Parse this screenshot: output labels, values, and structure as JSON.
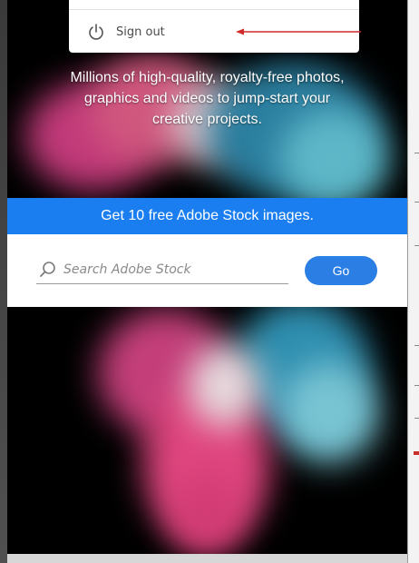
{
  "hero": {
    "tagline_lines": [
      "Millions of high-quality, royalty-free photos,",
      "graphics and videos to jump-start your",
      "creative projects."
    ]
  },
  "promo": {
    "text": "Get 10 free Adobe Stock images."
  },
  "search": {
    "placeholder": "Search Adobe Stock",
    "value": "",
    "go_label": "Go"
  },
  "account_menu": {
    "signout_label": "Sign out"
  },
  "colors": {
    "promo_blue": "#1b7ef0",
    "button_blue": "#2b7fe4",
    "annotation_red": "#d12a2a"
  },
  "icons": {
    "search": "search-icon",
    "power": "power-icon"
  }
}
